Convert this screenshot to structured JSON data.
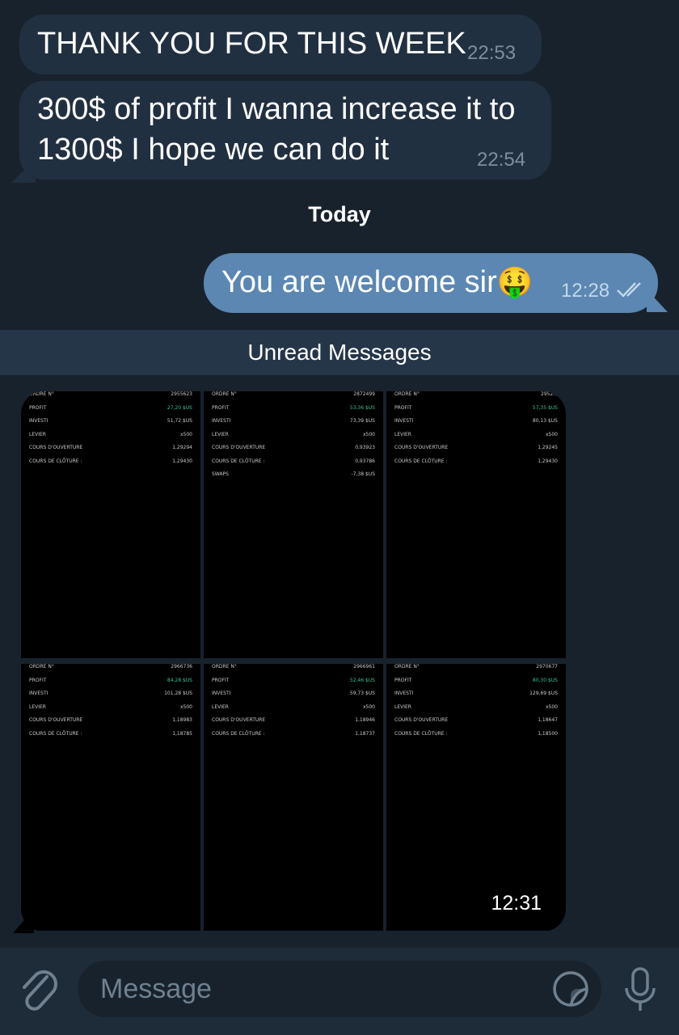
{
  "messages": [
    {
      "text": "THANK YOU FOR THIS WEEK",
      "time": "22:53"
    },
    {
      "line1": "300$ of profit I wanna increase it to",
      "line2": "1300$ I hope we can do it",
      "time": "22:54"
    }
  ],
  "day_separator": "Today",
  "outgoing": {
    "text": "You are welcome sir",
    "emoji": "🤑",
    "time": "12:28",
    "status_icon": "double-check-icon"
  },
  "unread_label": "Unread Messages",
  "album": {
    "time": "12:31",
    "tiles": [
      {
        "rows": [
          {
            "k": "ORDRE N°",
            "v": "2955623"
          },
          {
            "k": "PROFIT",
            "v": "27,20 $US",
            "green": true
          },
          {
            "k": "INVESTI",
            "v": "51,72 $US"
          },
          {
            "k": "LEVIER",
            "v": "x500"
          },
          {
            "k": "COURS D'OUVERTURE",
            "v": "1,29294"
          },
          {
            "k": "COURS DE CLÔTURE :",
            "v": "1,29430"
          }
        ]
      },
      {
        "rows": [
          {
            "k": "ORDRE N°",
            "v": "2872499"
          },
          {
            "k": "PROFIT",
            "v": "53,36 $US",
            "green": true
          },
          {
            "k": "INVESTI",
            "v": "73,39 $US"
          },
          {
            "k": "LEVIER",
            "v": "x500"
          },
          {
            "k": "COURS D'OUVERTURE",
            "v": "0,93923"
          },
          {
            "k": "COURS DE CLÔTURE :",
            "v": "0,93786"
          },
          {
            "k": "SWAPS",
            "v": "-7,38 $US"
          }
        ]
      },
      {
        "rows": [
          {
            "k": "ORDRE N°",
            "v": "2952..."
          },
          {
            "k": "PROFIT",
            "v": "57,35 $US",
            "green": true
          },
          {
            "k": "INVESTI",
            "v": "80,13 $US"
          },
          {
            "k": "LEVIER",
            "v": "x500"
          },
          {
            "k": "COURS D'OUVERTURE",
            "v": "1,29245"
          },
          {
            "k": "COURS DE CLÔTURE :",
            "v": "1,29430"
          }
        ]
      },
      {
        "rows": [
          {
            "k": "ORDRE N°",
            "v": "2966736"
          },
          {
            "k": "PROFIT",
            "v": "84,28 $US",
            "green": true
          },
          {
            "k": "INVESTI",
            "v": "101,28 $US"
          },
          {
            "k": "LEVIER",
            "v": "x500"
          },
          {
            "k": "COURS D'OUVERTURE",
            "v": "1,18983"
          },
          {
            "k": "COURS DE CLÔTURE :",
            "v": "1,18785"
          }
        ]
      },
      {
        "rows": [
          {
            "k": "ORDRE N°",
            "v": "2966961"
          },
          {
            "k": "PROFIT",
            "v": "52,46 $US",
            "green": true
          },
          {
            "k": "INVESTI",
            "v": "59,73 $US"
          },
          {
            "k": "LEVIER",
            "v": "x500"
          },
          {
            "k": "COURS D'OUVERTURE",
            "v": "1,18946"
          },
          {
            "k": "COURS DE CLÔTURE :",
            "v": "1,18737"
          }
        ]
      },
      {
        "rows": [
          {
            "k": "ORDRE N°",
            "v": "2970677"
          },
          {
            "k": "PROFIT",
            "v": "80,30 $US",
            "green": true
          },
          {
            "k": "INVESTI",
            "v": "129,69 $US"
          },
          {
            "k": "LEVIER",
            "v": "x500"
          },
          {
            "k": "COURS D'OUVERTURE",
            "v": "1,18647"
          },
          {
            "k": "COURS DE CLÔTURE :",
            "v": "1,18500"
          }
        ]
      }
    ]
  },
  "composer": {
    "placeholder": "Message",
    "attach_icon": "paperclip-icon",
    "sticker_icon": "sticker-icon",
    "mic_icon": "microphone-icon"
  },
  "colors": {
    "background": "#18222d",
    "incoming": "#213040",
    "outgoing": "#5b87b2",
    "profit_green": "#36c58a"
  }
}
